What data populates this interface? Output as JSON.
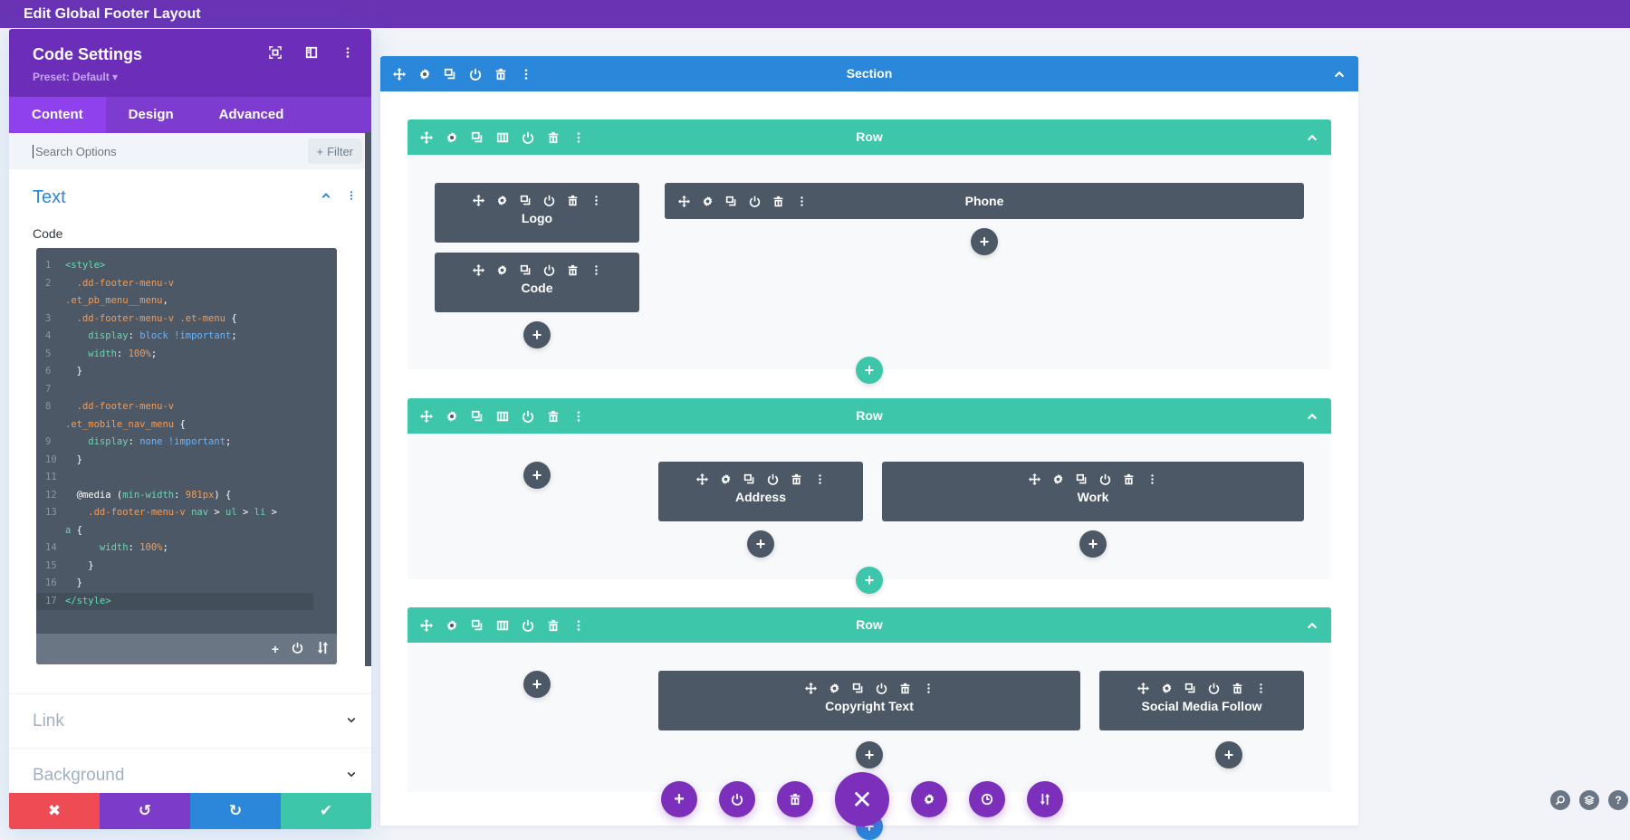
{
  "topbar": {
    "title": "Edit Global Footer Layout"
  },
  "panel": {
    "title": "Code Settings",
    "preset": "Preset: Default ▾",
    "header_icons": [
      "focus-icon",
      "sidebar-layout-icon",
      "more-vertical-icon"
    ],
    "tabs": [
      {
        "label": "Content",
        "active": true
      },
      {
        "label": "Design",
        "active": false
      },
      {
        "label": "Advanced",
        "active": false
      }
    ],
    "search": {
      "placeholder": "Search Options",
      "value": ""
    },
    "filter_label": "Filter",
    "text_group": {
      "title": "Text",
      "code_label": "Code",
      "code_lines": [
        {
          "n": "1",
          "tokens": [
            [
              "tag",
              "<style>"
            ]
          ]
        },
        {
          "n": "2",
          "tokens": [
            [
              "sel",
              "  .dd-footer-menu-v"
            ]
          ]
        },
        {
          "n": "",
          "tokens": [
            [
              "sel",
              ".et_pb_menu__menu"
            ],
            [
              "punc",
              ","
            ]
          ]
        },
        {
          "n": "3",
          "tokens": [
            [
              "sel",
              "  .dd-footer-menu-v .et-menu "
            ],
            [
              "punc",
              "{"
            ]
          ]
        },
        {
          "n": "4",
          "tokens": [
            [
              "prop",
              "    display"
            ],
            [
              "punc",
              ": "
            ],
            [
              "val",
              "block !important"
            ],
            [
              "punc",
              ";"
            ]
          ]
        },
        {
          "n": "5",
          "tokens": [
            [
              "prop",
              "    width"
            ],
            [
              "punc",
              ": "
            ],
            [
              "num",
              "100%"
            ],
            [
              "punc",
              ";"
            ]
          ]
        },
        {
          "n": "6",
          "tokens": [
            [
              "punc",
              "  }"
            ]
          ]
        },
        {
          "n": "7",
          "tokens": []
        },
        {
          "n": "8",
          "tokens": [
            [
              "sel",
              "  .dd-footer-menu-v"
            ]
          ]
        },
        {
          "n": "",
          "tokens": [
            [
              "sel",
              ".et_mobile_nav_menu "
            ],
            [
              "punc",
              "{"
            ]
          ]
        },
        {
          "n": "9",
          "tokens": [
            [
              "prop",
              "    display"
            ],
            [
              "punc",
              ": "
            ],
            [
              "val",
              "none !important"
            ],
            [
              "punc",
              ";"
            ]
          ]
        },
        {
          "n": "10",
          "tokens": [
            [
              "punc",
              "  }"
            ]
          ]
        },
        {
          "n": "11",
          "tokens": []
        },
        {
          "n": "12",
          "tokens": [
            [
              "punc",
              "  @media ("
            ],
            [
              "prop",
              "min-width"
            ],
            [
              "punc",
              ": "
            ],
            [
              "num",
              "981px"
            ],
            [
              "punc",
              ") {"
            ]
          ]
        },
        {
          "n": "13",
          "tokens": [
            [
              "sel",
              "    .dd-footer-menu-v "
            ],
            [
              "prop",
              "nav "
            ],
            [
              "punc",
              "> "
            ],
            [
              "prop",
              "ul "
            ],
            [
              "punc",
              "> "
            ],
            [
              "prop",
              "li "
            ],
            [
              "punc",
              ">"
            ]
          ]
        },
        {
          "n": "",
          "tokens": [
            [
              "prop",
              "a "
            ],
            [
              "punc",
              "{"
            ]
          ]
        },
        {
          "n": "14",
          "tokens": [
            [
              "prop",
              "      width"
            ],
            [
              "punc",
              ": "
            ],
            [
              "num",
              "100%"
            ],
            [
              "punc",
              ";"
            ]
          ]
        },
        {
          "n": "15",
          "tokens": [
            [
              "punc",
              "    }"
            ]
          ]
        },
        {
          "n": "16",
          "tokens": [
            [
              "punc",
              "  }"
            ]
          ]
        },
        {
          "n": "17",
          "tokens": [
            [
              "tag",
              "</style>"
            ]
          ],
          "highlight": true
        }
      ],
      "code_footer_icons": [
        "plus-icon",
        "power-icon",
        "sort-icon"
      ]
    },
    "groups": [
      {
        "title": "Link"
      },
      {
        "title": "Background"
      }
    ],
    "actions": [
      {
        "name": "cancel",
        "glyph": "✖",
        "color": "#ef4b55"
      },
      {
        "name": "undo",
        "glyph": "↺",
        "color": "#7d3bc9"
      },
      {
        "name": "redo",
        "glyph": "↻",
        "color": "#2b87da"
      },
      {
        "name": "save",
        "glyph": "✔",
        "color": "#3ec6aa"
      }
    ]
  },
  "builder": {
    "section": {
      "label": "Section"
    },
    "rows": [
      {
        "label": "Row",
        "modules": [
          {
            "label": "Logo"
          },
          {
            "label": "Code"
          },
          {
            "label": "Phone"
          }
        ]
      },
      {
        "label": "Row",
        "modules": [
          {
            "label": "Address"
          },
          {
            "label": "Work"
          }
        ]
      },
      {
        "label": "Row",
        "modules": [
          {
            "label": "Copyright Text"
          },
          {
            "label": "Social Media Follow"
          }
        ]
      }
    ]
  },
  "bottom_toolbar": {
    "buttons": [
      "add",
      "power",
      "trash",
      "close",
      "settings",
      "history",
      "portability"
    ]
  },
  "corner_buttons": [
    "search",
    "layers",
    "help"
  ],
  "colors": {
    "purple": "#6933b4",
    "section_blue": "#2b87da",
    "row_green": "#3ec6aa",
    "module_gray": "#4c5866",
    "danger": "#ef4b55"
  }
}
